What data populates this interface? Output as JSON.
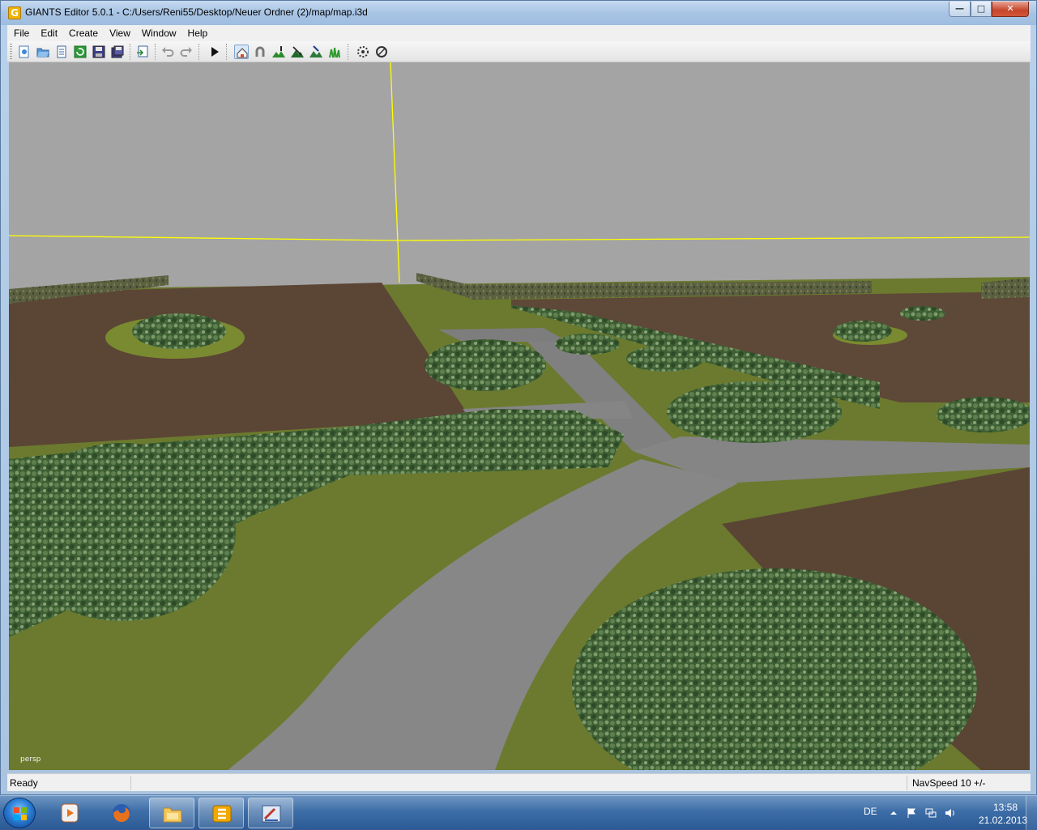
{
  "window": {
    "title": "GIANTS Editor 5.0.1 - C:/Users/Reni55/Desktop/Neuer Ordner (2)/map/map.i3d",
    "app_icon_letter": "G",
    "minimize_icon": "minimize-icon",
    "maximize_icon": "maximize-icon",
    "close_icon": "close-icon"
  },
  "menu": {
    "items": [
      "File",
      "Edit",
      "Create",
      "View",
      "Window",
      "Help"
    ]
  },
  "toolbar": {
    "buttons": [
      {
        "name": "new-scene-icon"
      },
      {
        "name": "open-icon"
      },
      {
        "name": "document-icon"
      },
      {
        "name": "reload-icon"
      },
      {
        "name": "save-icon"
      },
      {
        "name": "save-all-icon"
      },
      {
        "name": "import-icon"
      },
      {
        "name": "undo-icon"
      },
      {
        "name": "redo-icon"
      },
      {
        "name": "play-icon"
      },
      {
        "name": "select-tool-icon"
      },
      {
        "name": "magnet-icon"
      },
      {
        "name": "terrain-paint-icon"
      },
      {
        "name": "terrain-sculpt-icon"
      },
      {
        "name": "foliage-icon"
      },
      {
        "name": "grass-icon"
      },
      {
        "name": "render-settings-icon"
      },
      {
        "name": "render-wireframe-icon"
      }
    ]
  },
  "viewport": {
    "camera_label": "persp"
  },
  "status": {
    "text": "Ready",
    "nav_speed": "NavSpeed 10 +/-"
  },
  "taskbar": {
    "items": [
      "start-orb",
      "media-player-icon",
      "firefox-icon",
      "file-explorer-icon",
      "giants-editor-icon",
      "paint-icon"
    ],
    "language": "DE",
    "time": "13:58",
    "date": "21.02.2013"
  }
}
